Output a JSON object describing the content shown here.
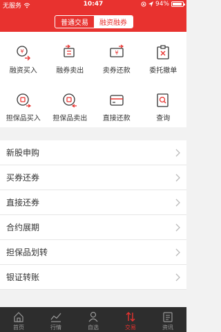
{
  "status_bar": {
    "carrier": "无服务",
    "time": "10:47",
    "battery": "94%",
    "battery_level": 0.94
  },
  "header": {
    "tabs": [
      {
        "label": "普通交易",
        "active": false
      },
      {
        "label": "融资融券",
        "active": true
      }
    ]
  },
  "grid": {
    "items": [
      {
        "label": "融资买入",
        "icon": "yuan-in-icon"
      },
      {
        "label": "融券卖出",
        "icon": "ticket-out-icon"
      },
      {
        "label": "卖券还款",
        "icon": "yuan-ticket-icon"
      },
      {
        "label": "委托撤单",
        "icon": "cancel-order-icon"
      },
      {
        "label": "担保品买入",
        "icon": "collateral-buy-icon"
      },
      {
        "label": "担保品卖出",
        "icon": "collateral-sell-icon"
      },
      {
        "label": "直接还款",
        "icon": "card-icon"
      },
      {
        "label": "查询",
        "icon": "search-icon"
      }
    ]
  },
  "list": {
    "items": [
      {
        "label": "新股申购"
      },
      {
        "label": "买券还券"
      },
      {
        "label": "直接还券"
      },
      {
        "label": "合约展期"
      },
      {
        "label": "担保品划转"
      },
      {
        "label": "银证转账"
      }
    ]
  },
  "tabbar": {
    "items": [
      {
        "label": "首页",
        "icon": "home-icon",
        "active": false
      },
      {
        "label": "行情",
        "icon": "chart-icon",
        "active": false
      },
      {
        "label": "自选",
        "icon": "person-icon",
        "active": false
      },
      {
        "label": "交易",
        "icon": "trade-icon",
        "active": true
      },
      {
        "label": "资讯",
        "icon": "news-icon",
        "active": false
      }
    ]
  },
  "colors": {
    "accent": "#e8322f",
    "tabbar_bg": "#2d2d2d"
  }
}
